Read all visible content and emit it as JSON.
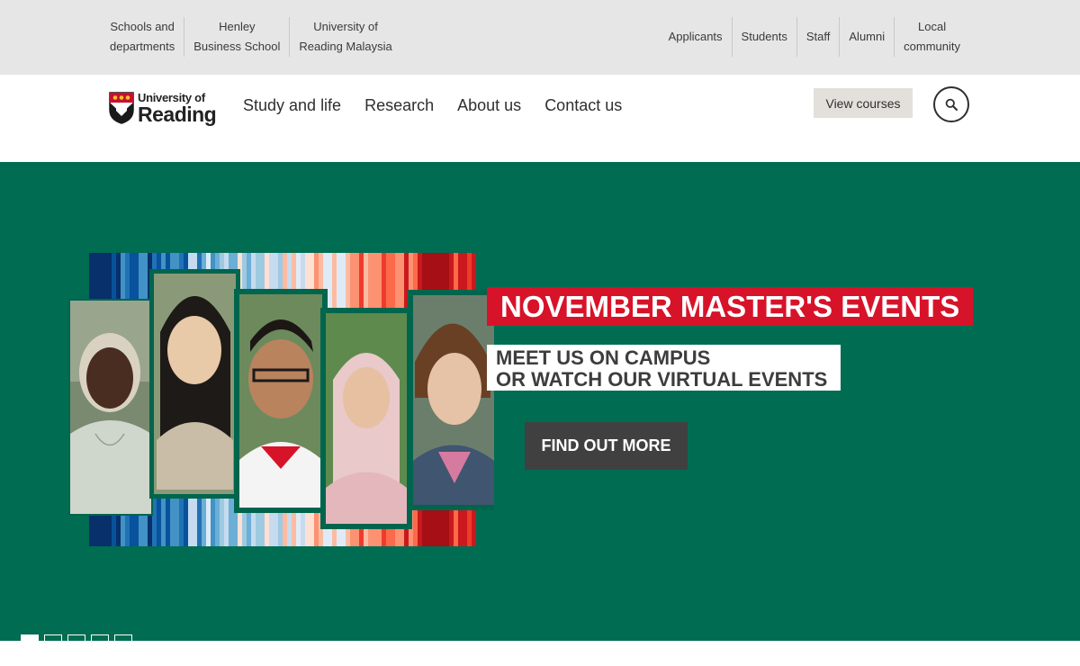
{
  "utility_bar": {
    "left_links": [
      {
        "line1": "Schools and",
        "line2": "departments"
      },
      {
        "line1": "Henley",
        "line2": "Business School"
      },
      {
        "line1": "University of",
        "line2": "Reading Malaysia"
      }
    ],
    "right_links": [
      {
        "line1": "Applicants"
      },
      {
        "line1": "Students"
      },
      {
        "line1": "Staff"
      },
      {
        "line1": "Alumni"
      },
      {
        "line1": "Local",
        "line2": "community"
      }
    ]
  },
  "logo": {
    "line1": "University of",
    "line2": "Reading"
  },
  "nav": {
    "items": [
      "Study and life",
      "Research",
      "About us",
      "Contact us"
    ],
    "view_courses": "View courses",
    "search_icon": "search-icon"
  },
  "hero": {
    "headline": "NOVEMBER MASTER'S EVENTS",
    "subhead_line1": "MEET US ON CAMPUS",
    "subhead_line2": "OR WATCH OUR VIRTUAL EVENTS",
    "cta": "FIND OUT MORE",
    "slide_count": 5,
    "active_slide": 1
  },
  "colors": {
    "hero_bg": "#006c52",
    "headline_bg": "#d7132a",
    "cta_bg": "#404040",
    "utility_bg": "#e6e6e6"
  }
}
